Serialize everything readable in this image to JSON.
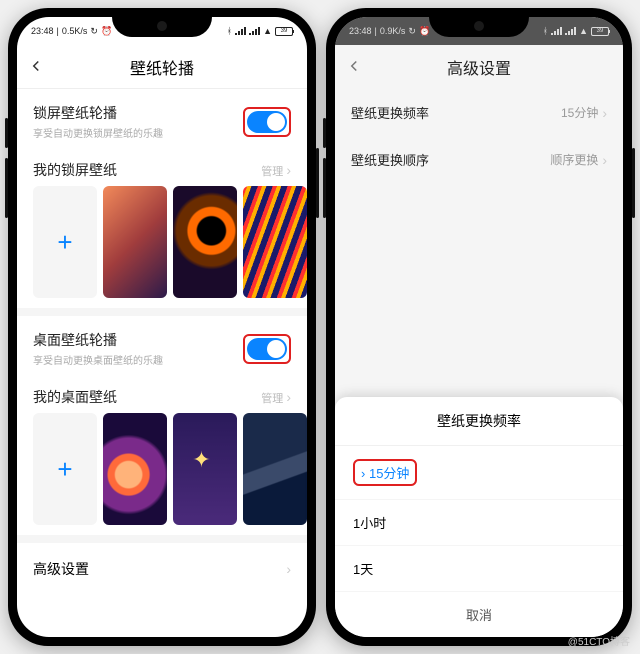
{
  "status": {
    "time": "23:48",
    "speed_left": "0.5K/s",
    "speed_right": "0.9K/s",
    "battery": "39"
  },
  "left": {
    "title": "壁纸轮播",
    "lock": {
      "label": "锁屏壁纸轮播",
      "sub": "享受自动更换锁屏壁纸的乐趣"
    },
    "my_lock": "我的锁屏壁纸",
    "manage": "管理",
    "desk": {
      "label": "桌面壁纸轮播",
      "sub": "享受自动更换桌面壁纸的乐趣"
    },
    "my_desk": "我的桌面壁纸",
    "advanced": "高级设置"
  },
  "right": {
    "title": "高级设置",
    "freq": {
      "label": "壁纸更换频率",
      "value": "15分钟"
    },
    "order": {
      "label": "壁纸更换顺序",
      "value": "顺序更换"
    },
    "sheet": {
      "title": "壁纸更换频率",
      "opt1": "15分钟",
      "opt2": "1小时",
      "opt3": "1天",
      "cancel": "取消"
    }
  },
  "watermark": "@51CTO博客"
}
